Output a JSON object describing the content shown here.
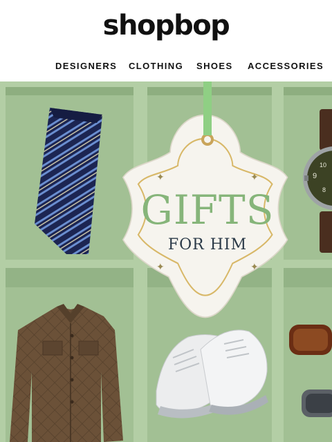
{
  "brand": {
    "logo_text": "shopbop"
  },
  "nav": {
    "items": [
      {
        "label": "DESIGNERS"
      },
      {
        "label": "CLOTHING"
      },
      {
        "label": "SHOES"
      },
      {
        "label": "ACCESSORIES"
      }
    ]
  },
  "hero": {
    "tag_headline": "GIFTS",
    "tag_subline": "FOR HIM"
  },
  "colors": {
    "box_green": "#9dbb8f",
    "tag_headline": "#86b57a",
    "tag_subline": "#2b3a48",
    "gold": "#d8b868"
  },
  "icons": [
    "sparkle-icon"
  ]
}
